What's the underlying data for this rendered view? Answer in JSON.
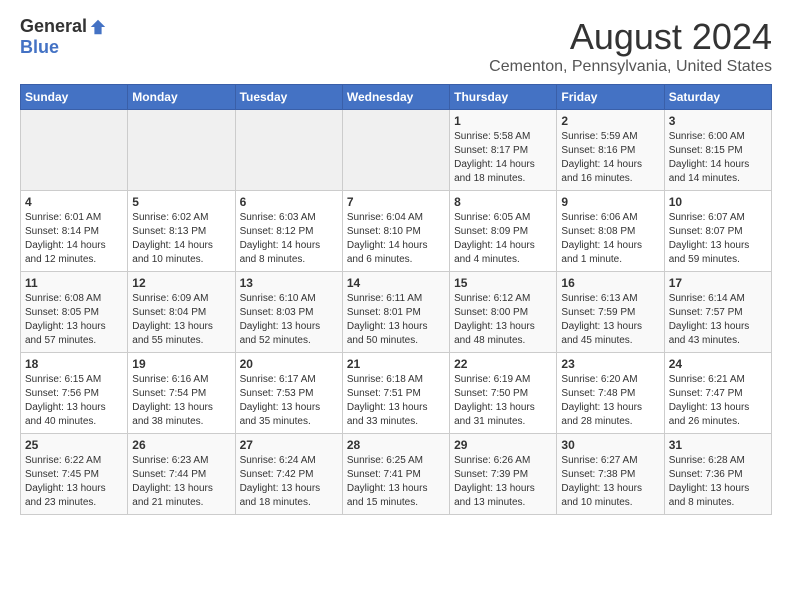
{
  "header": {
    "logo_general": "General",
    "logo_blue": "Blue",
    "month_title": "August 2024",
    "location": "Cementon, Pennsylvania, United States"
  },
  "weekdays": [
    "Sunday",
    "Monday",
    "Tuesday",
    "Wednesday",
    "Thursday",
    "Friday",
    "Saturday"
  ],
  "weeks": [
    [
      {
        "day": "",
        "info": ""
      },
      {
        "day": "",
        "info": ""
      },
      {
        "day": "",
        "info": ""
      },
      {
        "day": "",
        "info": ""
      },
      {
        "day": "1",
        "info": "Sunrise: 5:58 AM\nSunset: 8:17 PM\nDaylight: 14 hours\nand 18 minutes."
      },
      {
        "day": "2",
        "info": "Sunrise: 5:59 AM\nSunset: 8:16 PM\nDaylight: 14 hours\nand 16 minutes."
      },
      {
        "day": "3",
        "info": "Sunrise: 6:00 AM\nSunset: 8:15 PM\nDaylight: 14 hours\nand 14 minutes."
      }
    ],
    [
      {
        "day": "4",
        "info": "Sunrise: 6:01 AM\nSunset: 8:14 PM\nDaylight: 14 hours\nand 12 minutes."
      },
      {
        "day": "5",
        "info": "Sunrise: 6:02 AM\nSunset: 8:13 PM\nDaylight: 14 hours\nand 10 minutes."
      },
      {
        "day": "6",
        "info": "Sunrise: 6:03 AM\nSunset: 8:12 PM\nDaylight: 14 hours\nand 8 minutes."
      },
      {
        "day": "7",
        "info": "Sunrise: 6:04 AM\nSunset: 8:10 PM\nDaylight: 14 hours\nand 6 minutes."
      },
      {
        "day": "8",
        "info": "Sunrise: 6:05 AM\nSunset: 8:09 PM\nDaylight: 14 hours\nand 4 minutes."
      },
      {
        "day": "9",
        "info": "Sunrise: 6:06 AM\nSunset: 8:08 PM\nDaylight: 14 hours\nand 1 minute."
      },
      {
        "day": "10",
        "info": "Sunrise: 6:07 AM\nSunset: 8:07 PM\nDaylight: 13 hours\nand 59 minutes."
      }
    ],
    [
      {
        "day": "11",
        "info": "Sunrise: 6:08 AM\nSunset: 8:05 PM\nDaylight: 13 hours\nand 57 minutes."
      },
      {
        "day": "12",
        "info": "Sunrise: 6:09 AM\nSunset: 8:04 PM\nDaylight: 13 hours\nand 55 minutes."
      },
      {
        "day": "13",
        "info": "Sunrise: 6:10 AM\nSunset: 8:03 PM\nDaylight: 13 hours\nand 52 minutes."
      },
      {
        "day": "14",
        "info": "Sunrise: 6:11 AM\nSunset: 8:01 PM\nDaylight: 13 hours\nand 50 minutes."
      },
      {
        "day": "15",
        "info": "Sunrise: 6:12 AM\nSunset: 8:00 PM\nDaylight: 13 hours\nand 48 minutes."
      },
      {
        "day": "16",
        "info": "Sunrise: 6:13 AM\nSunset: 7:59 PM\nDaylight: 13 hours\nand 45 minutes."
      },
      {
        "day": "17",
        "info": "Sunrise: 6:14 AM\nSunset: 7:57 PM\nDaylight: 13 hours\nand 43 minutes."
      }
    ],
    [
      {
        "day": "18",
        "info": "Sunrise: 6:15 AM\nSunset: 7:56 PM\nDaylight: 13 hours\nand 40 minutes."
      },
      {
        "day": "19",
        "info": "Sunrise: 6:16 AM\nSunset: 7:54 PM\nDaylight: 13 hours\nand 38 minutes."
      },
      {
        "day": "20",
        "info": "Sunrise: 6:17 AM\nSunset: 7:53 PM\nDaylight: 13 hours\nand 35 minutes."
      },
      {
        "day": "21",
        "info": "Sunrise: 6:18 AM\nSunset: 7:51 PM\nDaylight: 13 hours\nand 33 minutes."
      },
      {
        "day": "22",
        "info": "Sunrise: 6:19 AM\nSunset: 7:50 PM\nDaylight: 13 hours\nand 31 minutes."
      },
      {
        "day": "23",
        "info": "Sunrise: 6:20 AM\nSunset: 7:48 PM\nDaylight: 13 hours\nand 28 minutes."
      },
      {
        "day": "24",
        "info": "Sunrise: 6:21 AM\nSunset: 7:47 PM\nDaylight: 13 hours\nand 26 minutes."
      }
    ],
    [
      {
        "day": "25",
        "info": "Sunrise: 6:22 AM\nSunset: 7:45 PM\nDaylight: 13 hours\nand 23 minutes."
      },
      {
        "day": "26",
        "info": "Sunrise: 6:23 AM\nSunset: 7:44 PM\nDaylight: 13 hours\nand 21 minutes."
      },
      {
        "day": "27",
        "info": "Sunrise: 6:24 AM\nSunset: 7:42 PM\nDaylight: 13 hours\nand 18 minutes."
      },
      {
        "day": "28",
        "info": "Sunrise: 6:25 AM\nSunset: 7:41 PM\nDaylight: 13 hours\nand 15 minutes."
      },
      {
        "day": "29",
        "info": "Sunrise: 6:26 AM\nSunset: 7:39 PM\nDaylight: 13 hours\nand 13 minutes."
      },
      {
        "day": "30",
        "info": "Sunrise: 6:27 AM\nSunset: 7:38 PM\nDaylight: 13 hours\nand 10 minutes."
      },
      {
        "day": "31",
        "info": "Sunrise: 6:28 AM\nSunset: 7:36 PM\nDaylight: 13 hours\nand 8 minutes."
      }
    ]
  ]
}
